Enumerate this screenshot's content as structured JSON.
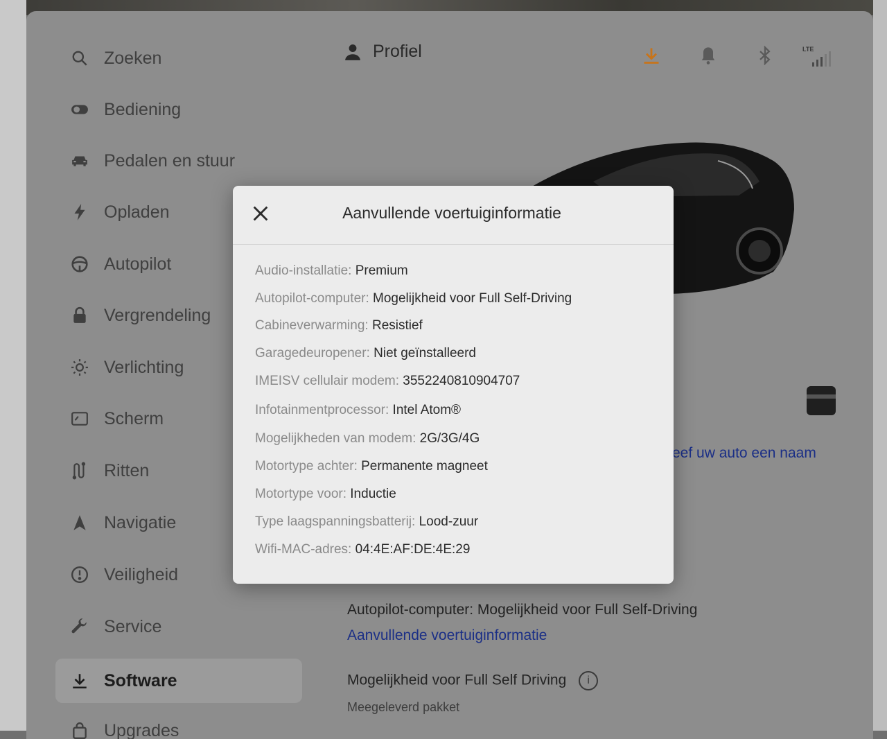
{
  "sidebar": {
    "items": [
      {
        "label": "Zoeken",
        "icon": "search-icon"
      },
      {
        "label": "Bediening",
        "icon": "toggle-icon"
      },
      {
        "label": "Pedalen en stuur",
        "icon": "car-icon"
      },
      {
        "label": "Opladen",
        "icon": "bolt-icon"
      },
      {
        "label": "Autopilot",
        "icon": "steering-wheel-icon"
      },
      {
        "label": "Vergrendeling",
        "icon": "lock-icon"
      },
      {
        "label": "Verlichting",
        "icon": "sun-icon"
      },
      {
        "label": "Scherm",
        "icon": "display-icon"
      },
      {
        "label": "Ritten",
        "icon": "trips-icon"
      },
      {
        "label": "Navigatie",
        "icon": "navigation-arrow-icon"
      },
      {
        "label": "Veiligheid",
        "icon": "alert-circle-icon"
      },
      {
        "label": "Service",
        "icon": "wrench-icon"
      },
      {
        "label": "Software",
        "icon": "download-icon",
        "selected": true
      },
      {
        "label": "Upgrades",
        "icon": "bag-icon"
      }
    ]
  },
  "header": {
    "profile_label": "Profiel",
    "network_label": "LTE",
    "download_color": "#c8741a"
  },
  "main": {
    "car_name_link": "eef uw auto een naam",
    "autopilot_line": "Autopilot-computer: Mogelijkheid voor Full Self-Driving",
    "more_info_link": "Aanvullende voertuiginformatie",
    "fsd_title": "Mogelijkheid voor Full Self Driving",
    "fsd_sub": "Meegeleverd pakket"
  },
  "modal": {
    "title": "Aanvullende voertuiginformatie",
    "rows": [
      {
        "label": "Audio-installatie:",
        "value": "Premium"
      },
      {
        "label": "Autopilot-computer:",
        "value": "Mogelijkheid voor Full Self-Driving"
      },
      {
        "label": "Cabineverwarming:",
        "value": "Resistief"
      },
      {
        "label": "Garagedeuropener:",
        "value": "Niet geïnstalleerd"
      },
      {
        "label": "IMEISV cellulair modem:",
        "value": "3552240810904707"
      },
      {
        "label": "Infotainmentprocessor:",
        "value": "Intel Atom®"
      },
      {
        "label": "Mogelijkheden van modem:",
        "value": "2G/3G/4G"
      },
      {
        "label": "Motortype achter:",
        "value": "Permanente magneet"
      },
      {
        "label": "Motortype voor:",
        "value": "Inductie"
      },
      {
        "label": "Type laagspanningsbatterij:",
        "value": "Lood-zuur"
      },
      {
        "label": "Wifi-MAC-adres:",
        "value": "04:4E:AF:DE:4E:29"
      }
    ]
  },
  "colors": {
    "link_blue": "#1b2f86",
    "modal_bg": "#ececec",
    "overlay_bg": "#8d8d8d"
  }
}
